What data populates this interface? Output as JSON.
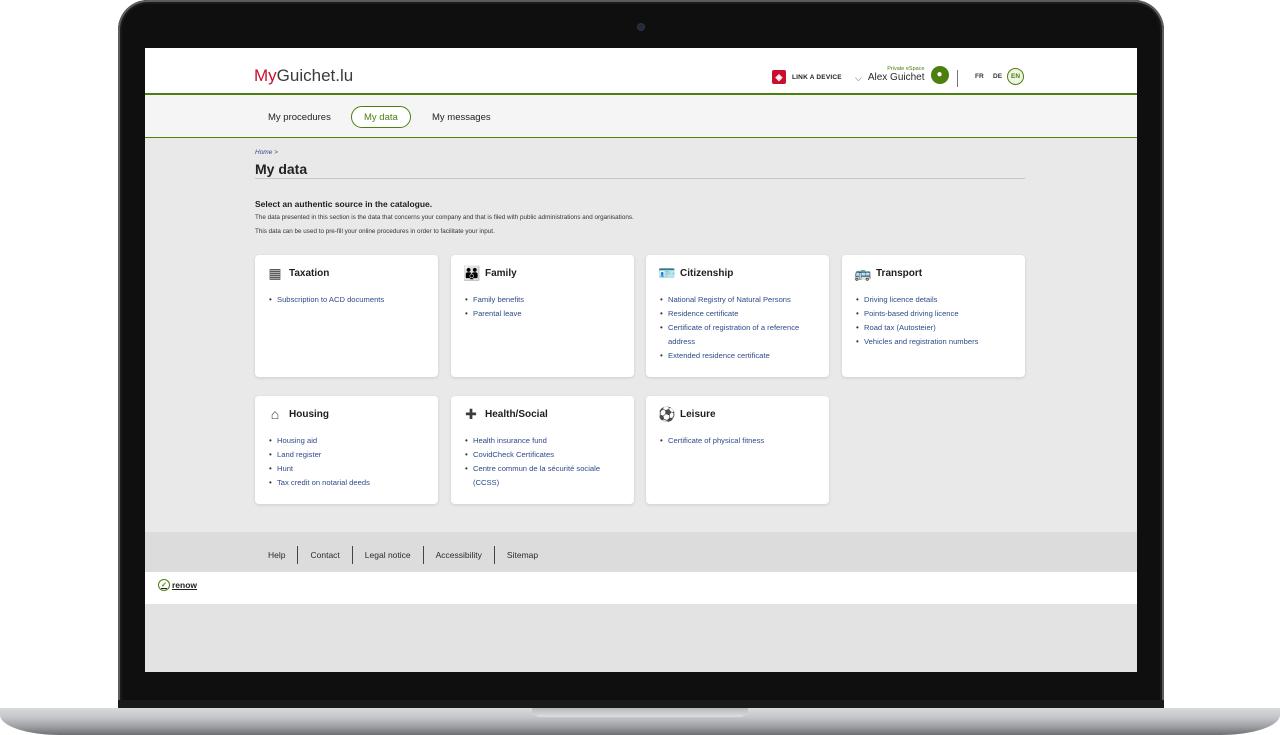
{
  "header": {
    "logo_my": "My",
    "logo_rest": "Guichet.lu",
    "link_device": "LINK A DEVICE",
    "space_label": "Private eSpace",
    "user_name": "Alex Guichet",
    "lang_fr": "FR",
    "lang_de": "DE",
    "lang_en": "EN"
  },
  "nav": {
    "items": [
      {
        "label": "My procedures"
      },
      {
        "label": "My data"
      },
      {
        "label": "My messages"
      }
    ],
    "active": "My data"
  },
  "breadcrumb": {
    "home": "Home",
    "separator": ">"
  },
  "page_title": "My data",
  "intro": {
    "heading": "Select an authentic source in the catalogue.",
    "line1": "The data presented in this section is the data that concerns your company and that is filed with public administrations and organisations.",
    "line2": "This data can be used to pre-fill your online procedures in order to facilitate your input."
  },
  "cards": [
    {
      "title": "Taxation",
      "icon": "building-icon",
      "links": [
        "Subscription to ACD documents"
      ]
    },
    {
      "title": "Family",
      "icon": "family-icon",
      "links": [
        "Family benefits",
        "Parental leave"
      ]
    },
    {
      "title": "Citizenship",
      "icon": "id-card-icon",
      "links": [
        "National Registry of Natural Persons",
        "Residence certificate",
        "Certificate of registration of a reference address",
        "Extended residence certificate"
      ]
    },
    {
      "title": "Transport",
      "icon": "bus-icon",
      "links": [
        "Driving licence details",
        "Points-based driving licence",
        "Road tax (Autosteier)",
        "Vehicles and registration numbers"
      ]
    },
    {
      "title": "Housing",
      "icon": "house-icon",
      "links": [
        "Housing aid",
        "Land register",
        "Hunt",
        "Tax credit on notarial deeds"
      ]
    },
    {
      "title": "Health/Social",
      "icon": "medical-kit-icon",
      "links": [
        "Health insurance fund",
        "CovidCheck Certificates",
        "Centre commun de la sécurité sociale (CCSS)"
      ]
    },
    {
      "title": "Leisure",
      "icon": "football-icon",
      "links": [
        "Certificate of physical fitness"
      ]
    }
  ],
  "footer": {
    "links": [
      "Help",
      "Contact",
      "Legal notice",
      "Accessibility",
      "Sitemap"
    ],
    "renow": "renow"
  },
  "colors": {
    "brand_green": "#4d7f0f",
    "brand_red": "#c8102e",
    "link_blue": "#2f4a8a"
  }
}
